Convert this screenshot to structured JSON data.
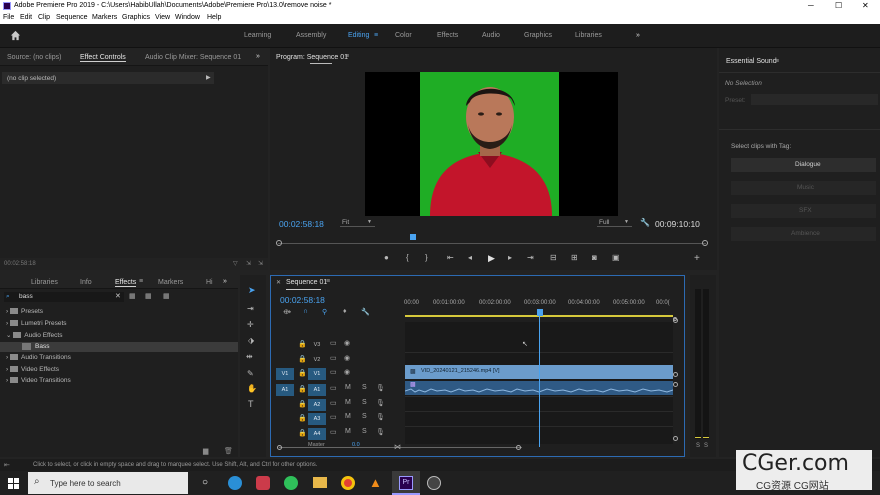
{
  "window": {
    "title": "Adobe Premiere Pro 2019 - C:\\Users\\HabibUllah\\Documents\\Adobe\\Premiere Pro\\13.0\\remove noise *",
    "min": "─",
    "max": "☐",
    "close": "✕"
  },
  "menu": [
    "File",
    "Edit",
    "Clip",
    "Sequence",
    "Markers",
    "Graphics",
    "View",
    "Window",
    "Help"
  ],
  "workspaces": [
    "Learning",
    "Assembly",
    "Editing",
    "Color",
    "Effects",
    "Audio",
    "Graphics",
    "Libraries"
  ],
  "workspace_more": "»",
  "active_workspace": "Editing",
  "source_panel": {
    "tabs": [
      "Source: (no clips)",
      "Effect Controls",
      "Audio Clip Mixer: Sequence 01"
    ],
    "more": "»",
    "no_clip": "(no clip selected)",
    "timecode": "00:02:58:18"
  },
  "program": {
    "title": "Program: Sequence 01",
    "menu_icon": "≡",
    "timecode": "00:02:58:18",
    "fit": "Fit",
    "quality": "Full",
    "duration": "00:09:10:10"
  },
  "essential_sound": {
    "title": "Essential Sound",
    "menu_icon": "≡",
    "no_selection": "No Selection",
    "preset": "Preset:",
    "select_clips": "Select clips with Tag:",
    "buttons": [
      "Dialogue",
      "Music",
      "SFX",
      "Ambience"
    ]
  },
  "effects_panel": {
    "tabs": [
      "Libraries",
      "Info",
      "Effects",
      "Markers",
      "Hi"
    ],
    "search": "bass",
    "tree": [
      "Presets",
      "Lumetri Presets",
      "Audio Effects",
      "Bass",
      "Audio Transitions",
      "Video Effects",
      "Video Transitions"
    ]
  },
  "timeline": {
    "title": "Sequence 01",
    "timecode": "00:02:58:18",
    "ruler": [
      "00:00",
      "00:01:00:00",
      "00:02:00:00",
      "00:03:00:00",
      "00:04:00:00",
      "00:05:00:00",
      "00:0("
    ],
    "video_tracks": [
      "V3",
      "V2",
      "V1"
    ],
    "audio_tracks": [
      "A1",
      "A2",
      "A3",
      "A4"
    ],
    "master": "Master",
    "master_value": "0.0",
    "clip_label": "VID_20240121_215246.mp4 [V]",
    "meter_labels": [
      "S",
      "S"
    ]
  },
  "statusbar": {
    "text": "Click to select, or click in empty space and drag to marquee select. Use Shift, Alt, and Ctrl for other options."
  },
  "taskbar": {
    "search": "Type here to search"
  },
  "watermark": {
    "main": "CGer.com",
    "sub": "CG资源 CG网站"
  },
  "colors": {
    "accent": "#4aa3f0",
    "track_selected": "#275a80",
    "clip_video": "#6b9ccc",
    "clip_audio": "#2f5a85",
    "green_screen": "#1fad25",
    "sweater": "#c3152b"
  }
}
